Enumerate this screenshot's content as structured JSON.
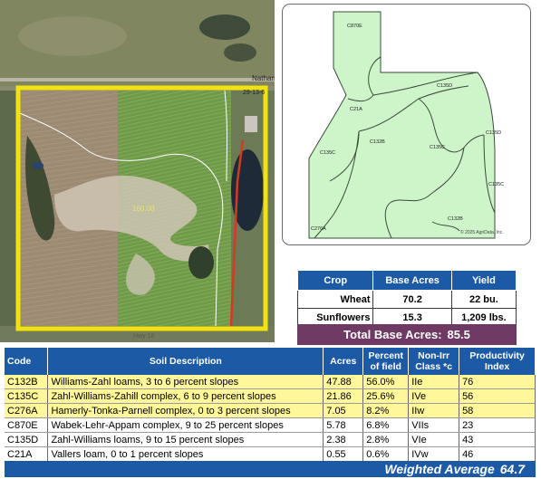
{
  "aerial": {
    "road_label": "Nathan",
    "section_label": "29-13-6",
    "acres_label": "160.00",
    "bottom_label": "Hwy 18"
  },
  "soil_map": {
    "labels": [
      "C870E",
      "C135D",
      "C21A",
      "C132B",
      "C135C",
      "C135C",
      "C135D",
      "C135C",
      "C132B",
      "C276A"
    ],
    "copyright": "© 2025 AgriData, Inc.",
    "fill_color": "#cdf5c9",
    "line_color": "#3c4a3c"
  },
  "crop_table": {
    "headers": [
      "Crop",
      "Base Acres",
      "Yield"
    ],
    "rows": [
      {
        "crop": "Wheat",
        "acres": "70.2",
        "yield": "22 bu."
      },
      {
        "crop": "Sunflowers",
        "acres": "15.3",
        "yield": "1,209 lbs."
      }
    ],
    "total_label": "Total Base Acres:",
    "total_value": "85.5"
  },
  "soil_table": {
    "headers": {
      "code": "Code",
      "description": "Soil Description",
      "acres": "Acres",
      "percent": "Percent of field",
      "class": "Non-Irr Class *c",
      "index": "Productivity Index"
    },
    "rows": [
      {
        "code": "C132B",
        "description": "Williams-Zahl loams, 3 to 6 percent slopes",
        "acres": "47.88",
        "percent": "56.0%",
        "class": "IIe",
        "index": "76",
        "highlight": true
      },
      {
        "code": "C135C",
        "description": "Zahl-Williams-Zahill complex, 6 to 9 percent slopes",
        "acres": "21.86",
        "percent": "25.6%",
        "class": "IVe",
        "index": "56",
        "highlight": true
      },
      {
        "code": "C276A",
        "description": "Hamerly-Tonka-Parnell complex, 0 to 3 percent slopes",
        "acres": "7.05",
        "percent": "8.2%",
        "class": "IIw",
        "index": "58",
        "highlight": true
      },
      {
        "code": "C870E",
        "description": "Wabek-Lehr-Appam complex, 9 to 25 percent slopes",
        "acres": "5.78",
        "percent": "6.8%",
        "class": "VIIs",
        "index": "23",
        "highlight": false
      },
      {
        "code": "C135D",
        "description": "Zahl-Williams loams, 9 to 15 percent slopes",
        "acres": "2.38",
        "percent": "2.8%",
        "class": "VIe",
        "index": "43",
        "highlight": false
      },
      {
        "code": "C21A",
        "description": "Vallers loam, 0 to 1 percent slopes",
        "acres": "0.55",
        "percent": "0.6%",
        "class": "IVw",
        "index": "46",
        "highlight": false
      }
    ],
    "weighted_label": "Weighted Average",
    "weighted_value": "64.7"
  },
  "colors": {
    "header_blue": "#1c5aa6",
    "total_purple": "#6e3a64",
    "highlight_yellow": "#fff79a",
    "boundary_yellow": "#f3e20f"
  }
}
